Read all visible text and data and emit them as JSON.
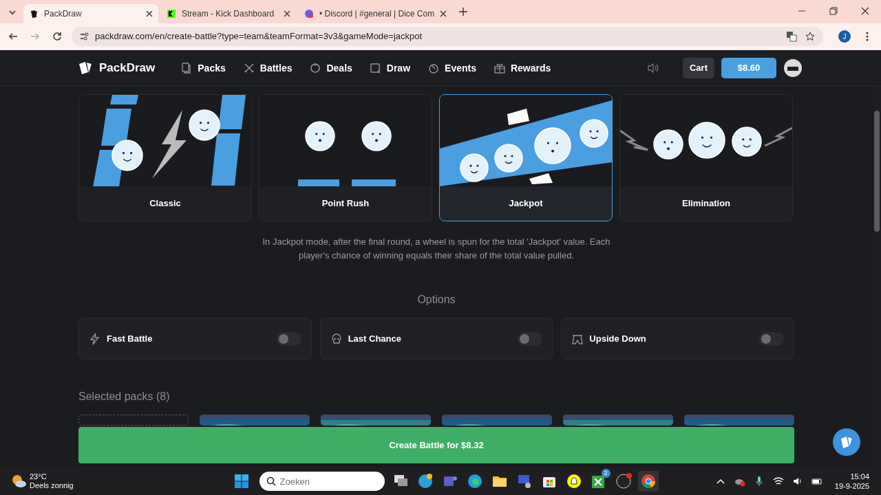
{
  "browser": {
    "tabs": [
      {
        "title": "PackDraw",
        "selected": true
      },
      {
        "title": "Stream - Kick Dashboard",
        "selected": false
      },
      {
        "title": "• Discord | #general | Dice Com",
        "selected": false
      }
    ],
    "url": "packdraw.com/en/create-battle?type=team&teamFormat=3v3&gameMode=jackpot",
    "profile": "J"
  },
  "site": {
    "brand": "PackDraw",
    "nav": [
      {
        "label": "Packs"
      },
      {
        "label": "Battles"
      },
      {
        "label": "Deals"
      },
      {
        "label": "Draw"
      },
      {
        "label": "Events"
      },
      {
        "label": "Rewards"
      }
    ],
    "cart": "Cart",
    "balance": "$8.60"
  },
  "modes": [
    {
      "label": "Classic",
      "selected": false
    },
    {
      "label": "Point Rush",
      "selected": false
    },
    {
      "label": "Jackpot",
      "selected": true
    },
    {
      "label": "Elimination",
      "selected": false
    }
  ],
  "description": "In Jackpot mode, after the final round, a wheel is spun for the total 'Jackpot' value. Each player's chance of winning equals their share of the total value pulled.",
  "options_title": "Options",
  "options": [
    {
      "label": "Fast Battle",
      "on": false
    },
    {
      "label": "Last Chance",
      "on": false
    },
    {
      "label": "Upside Down",
      "on": false
    }
  ],
  "packs_title": "Selected packs (8)",
  "packs": [
    {
      "kind": "empty"
    },
    {
      "kind": "picture"
    },
    {
      "kind": "picture"
    },
    {
      "kind": "picture"
    },
    {
      "kind": "picture"
    },
    {
      "kind": "picture"
    }
  ],
  "create_button": "Create Battle for $8.32",
  "taskbar": {
    "temperature": "23°C",
    "weather": "Deels zonnig",
    "search_placeholder": "Zoeken",
    "xbox_badge": "2",
    "time": "15:04",
    "date": "19-9-2025"
  }
}
